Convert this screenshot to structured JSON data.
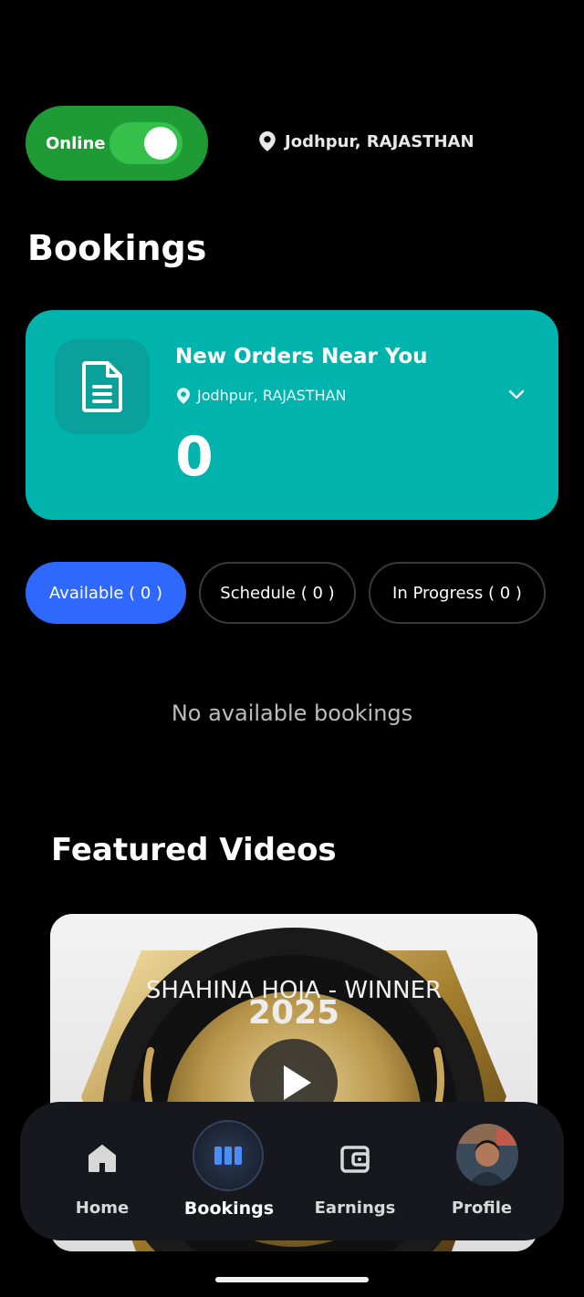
{
  "status": {
    "label": "Online",
    "enabled": true
  },
  "location": {
    "text": "Jodhpur, RAJASTHAN"
  },
  "bookings": {
    "title": "Bookings",
    "card": {
      "title": "New Orders Near You",
      "location": "Jodhpur, RAJASTHAN",
      "count": "0"
    },
    "tabs": [
      {
        "label": "Available ( 0 )",
        "active": true
      },
      {
        "label": "Schedule ( 0 )",
        "active": false
      },
      {
        "label": "In Progress ( 0 )",
        "active": false
      }
    ],
    "empty_message": "No available bookings"
  },
  "featured": {
    "title": "Featured Videos",
    "video": {
      "badge_text": "SHAHINA HOJA - WINNER",
      "year": "2025"
    }
  },
  "nav": {
    "items": [
      {
        "label": "Home",
        "icon": "home-icon",
        "active": false
      },
      {
        "label": "Bookings",
        "icon": "bookings-icon",
        "active": true
      },
      {
        "label": "Earnings",
        "icon": "wallet-icon",
        "active": false
      },
      {
        "label": "Profile",
        "icon": "avatar",
        "active": false
      }
    ]
  },
  "colors": {
    "online_green": "#1f9b35",
    "card_teal": "#00b3ad",
    "active_tab_blue": "#2f68ff",
    "nav_bg": "#16181d"
  }
}
